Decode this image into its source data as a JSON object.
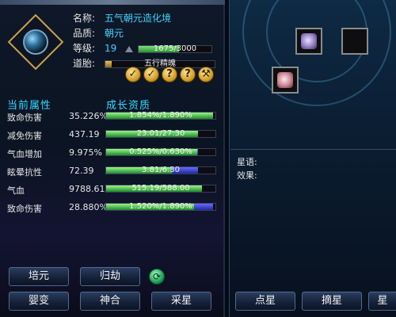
{
  "character": {
    "name_label": "名称:",
    "name_value": "五气朝元造化境",
    "quality_label": "品质:",
    "quality_value": "朝元",
    "level_label": "等级:",
    "level_value": "19",
    "exp_text": "1675/3000",
    "exp_progress": 0.558,
    "embryo_label": "道胎:",
    "embryo_value": "五行精魄",
    "embryo_progress": 0.06,
    "action_icons": [
      "check-icon",
      "check-icon",
      "question-icon",
      "question-icon",
      "hammer-icon"
    ]
  },
  "stats": {
    "header_current": "当前属性",
    "header_growth": "成长资质",
    "rows": [
      {
        "name": "致命伤害",
        "value": "35.226%",
        "growth": "1.854%/1.890%",
        "ratio": 0.981
      },
      {
        "name": "减免伤害",
        "value": "437.19",
        "growth": "23.01/27.30",
        "ratio": 0.843
      },
      {
        "name": "气血增加",
        "value": "9.975%",
        "growth": "0.525%/0.630%",
        "ratio": 0.833
      },
      {
        "name": "眩晕抗性",
        "value": "72.39",
        "growth": "3.81/6.30",
        "ratio": 0.605
      },
      {
        "name": "气血",
        "value": "9788.61",
        "growth": "515.19/588.00",
        "ratio": 0.876
      },
      {
        "name": "致命伤害",
        "value": "28.880%",
        "growth": "1.520%/1.890%",
        "ratio": 0.804
      }
    ]
  },
  "buttons": {
    "peiyuan": "培元",
    "guijie": "归劫",
    "yingbian": "婴变",
    "shenhe": "神合",
    "caixing": "采星",
    "dianxing": "点星",
    "zhaixing": "摘星",
    "third_partial": "星"
  },
  "star_panel": {
    "star_label": "星语:",
    "effect_label": "效果:"
  },
  "colors": {
    "accent_cyan": "#3fd3ff",
    "gold": "#d4a02a",
    "panel_dark": "#0a1422"
  }
}
